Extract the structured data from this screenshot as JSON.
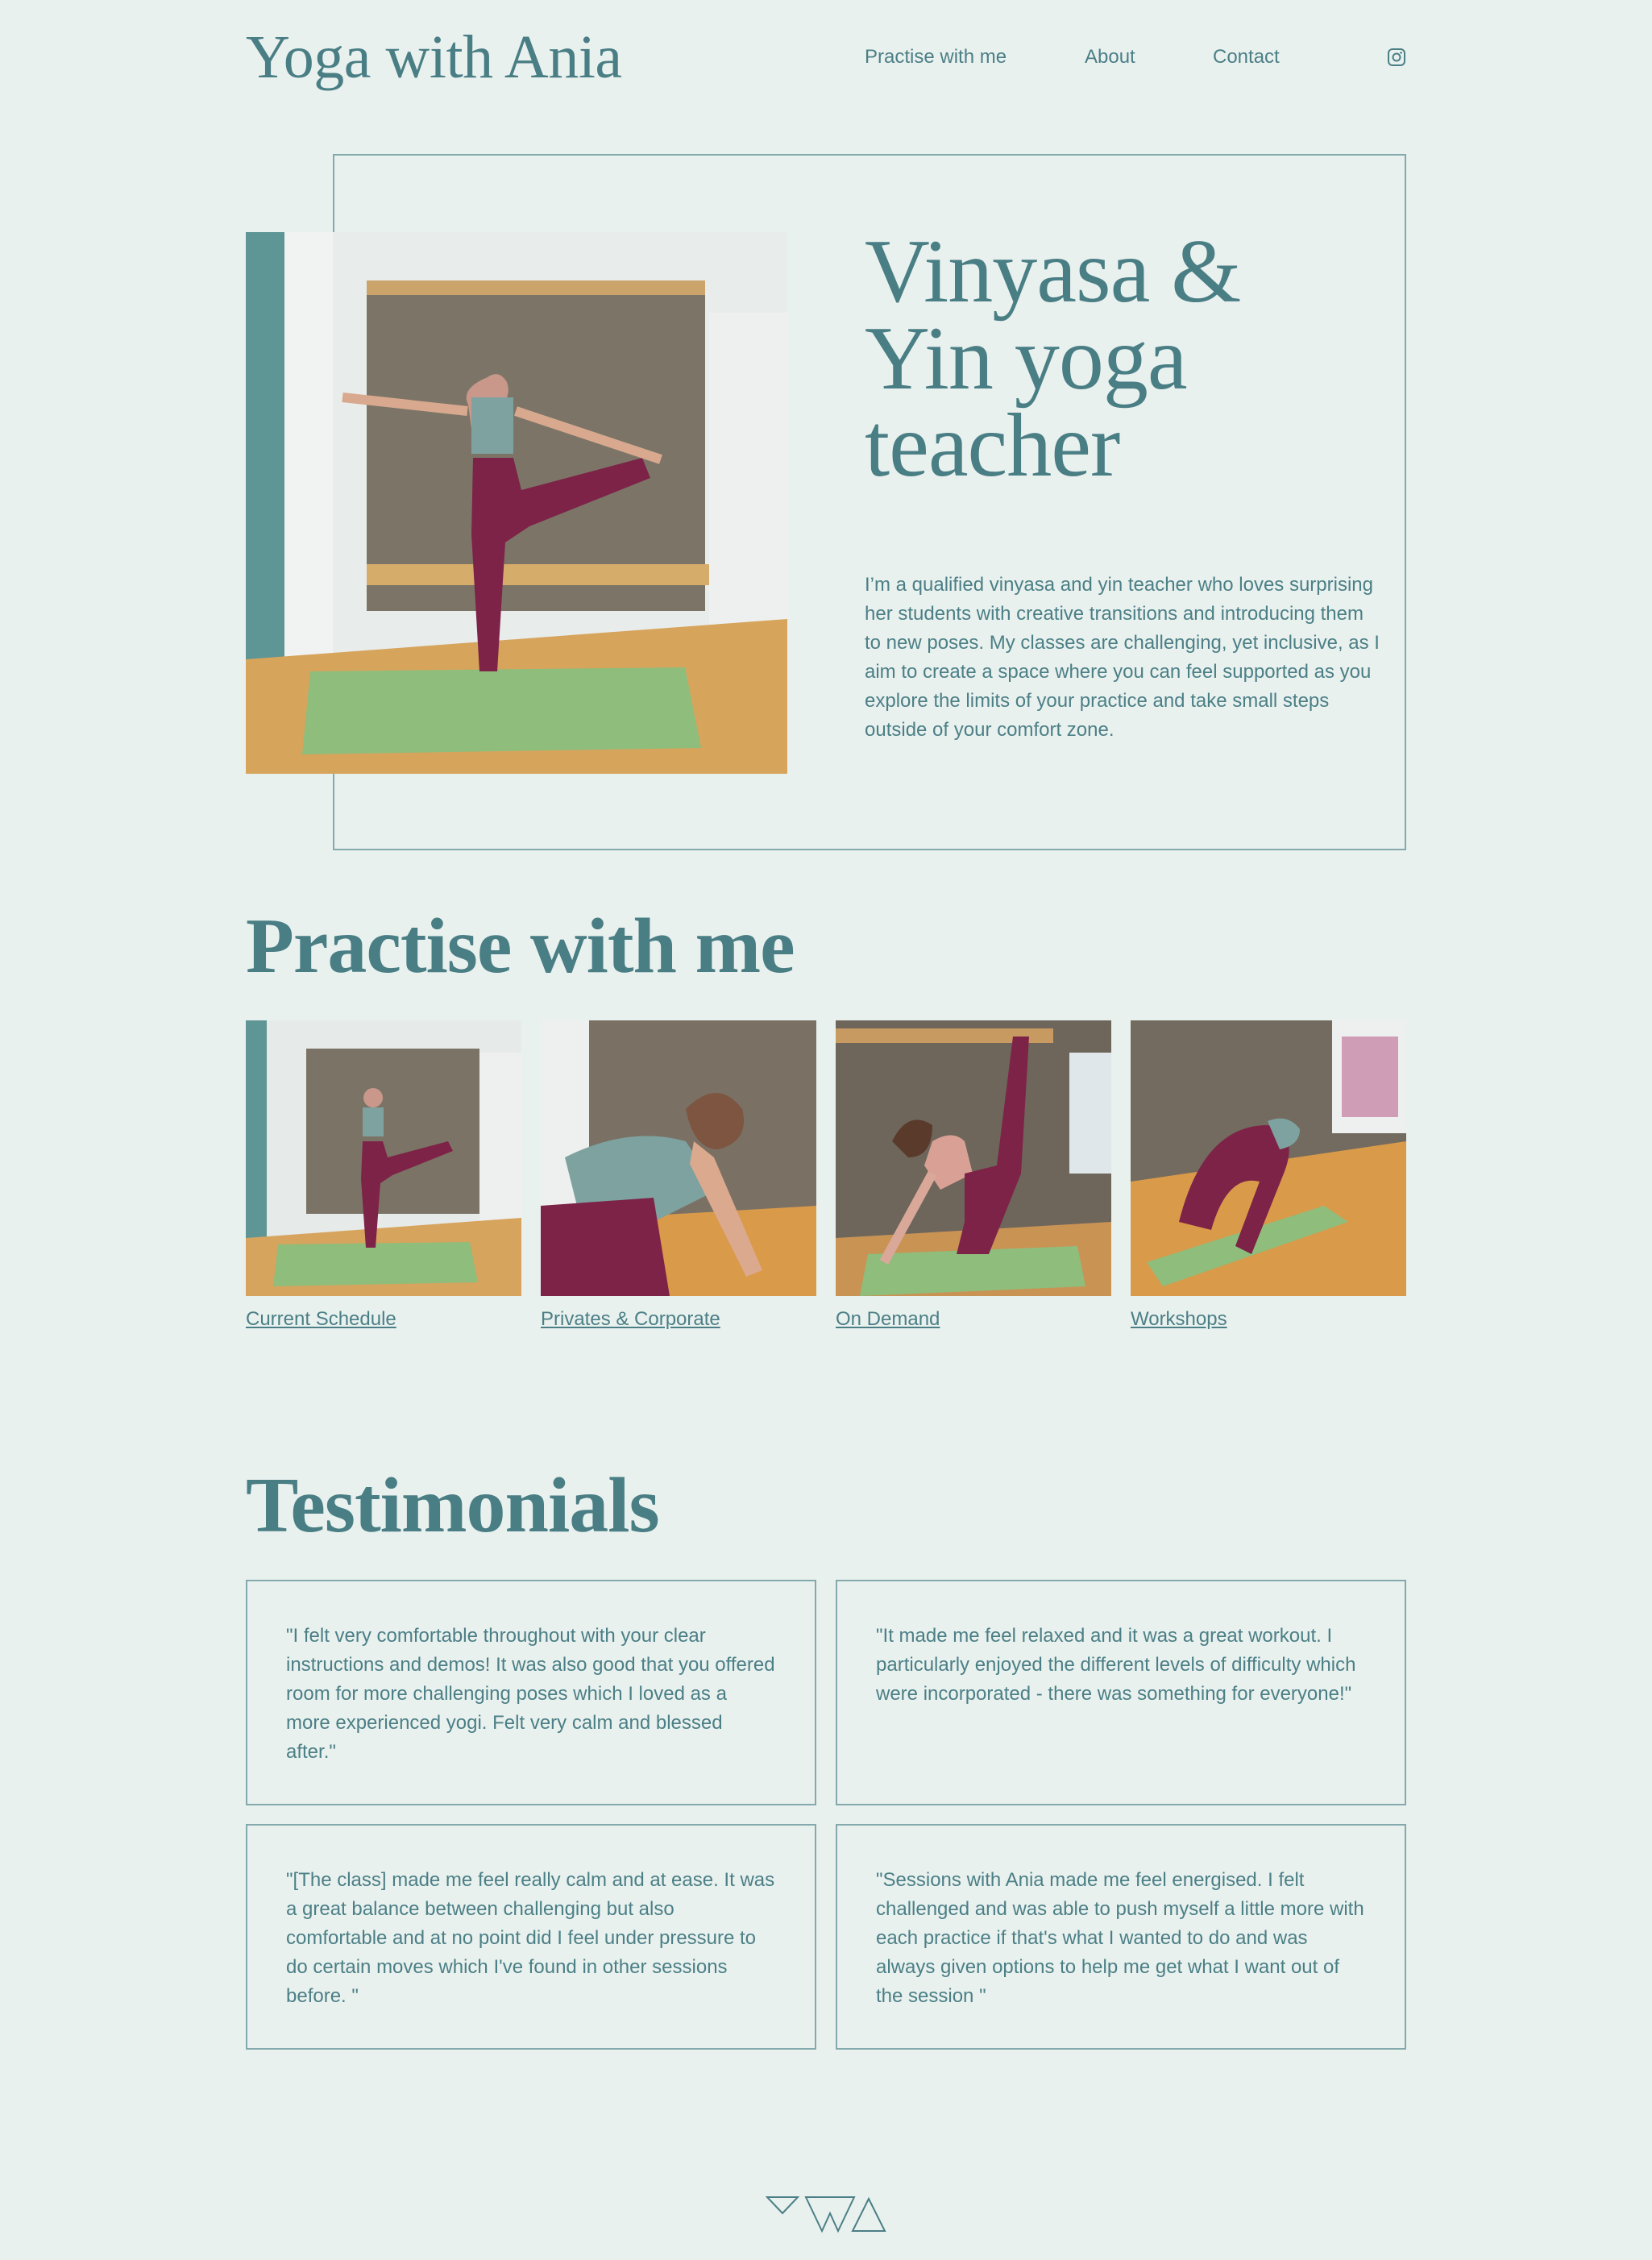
{
  "header": {
    "site_title": "Yoga with Ania",
    "nav": [
      "Practise with me",
      "About",
      "Contact"
    ],
    "social_icon": "instagram-icon"
  },
  "hero": {
    "title_line1": "Vinyasa &",
    "title_line2": "Yin yoga",
    "title_line3": "teacher",
    "paragraph": "I’m a qualified vinyasa and yin teacher who loves surprising her students with creative transitions and introducing them to new poses. My classes are challenging, yet inclusive, as I aim to create a space where you can feel supported as you explore the limits of your practice and take small steps outside of your comfort zone."
  },
  "practise": {
    "title": "Practise with me",
    "items": [
      {
        "label": "Current Schedule"
      },
      {
        "label": "Privates & Corporate"
      },
      {
        "label": "On Demand"
      },
      {
        "label": "Workshops"
      }
    ]
  },
  "testimonials": {
    "title": "Testimonials",
    "items": [
      "\"I felt very comfortable throughout with your clear instructions and demos! It was also good that you offered room for more challenging poses which I loved as a more experienced yogi. Felt very calm and blessed after.\"",
      "\"It made me feel relaxed and it was a great workout. I particularly enjoyed the different levels of difficulty which were incorporated - there was something for everyone!\"",
      "\"[The class] made me feel really calm and at ease. It was a great balance between challenging but also comfortable and at no point did I feel under pressure to do certain moves which I've found in other sessions before. \"",
      "\"Sessions with Ania made me feel energised. I felt challenged and was able to push myself a little more with each practice if that's what I wanted to do and was always given options to help me get what I want out of the session \""
    ]
  },
  "footer": {
    "logo_icon": "triangles-logo-icon"
  },
  "colors": {
    "background": "#e9f1ee",
    "text": "#4b7f86",
    "border": "#84a9ac"
  }
}
